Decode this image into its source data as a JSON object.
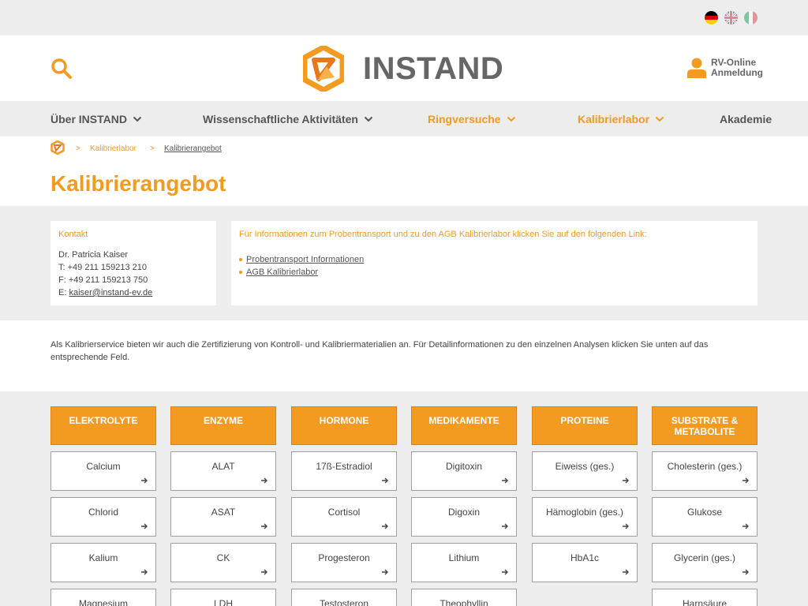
{
  "colors": {
    "accent": "#f39a21",
    "gray_bg": "#ededed",
    "text": "#444444"
  },
  "languages": [
    "Deutsch",
    "English",
    "Italiano"
  ],
  "brand": {
    "name": "INSTAND"
  },
  "header": {
    "login_line1": "RV-Online",
    "login_line2": "Anmeldung"
  },
  "nav": {
    "items": [
      {
        "label": "Über INSTAND"
      },
      {
        "label": "Wissenschaftliche Aktivitäten"
      },
      {
        "label": "Ringversuche"
      },
      {
        "label": "Kalibrierlabor"
      },
      {
        "label": "Akademie"
      }
    ]
  },
  "breadcrumb": {
    "sep": ">",
    "items": [
      "Kalibrierlabor",
      "Kalibrierangebot"
    ]
  },
  "page": {
    "title": "Kalibrierangebot"
  },
  "contact": {
    "label": "Kontakt",
    "name": "Dr. Patricia Kaiser",
    "phone": "T: +49 211 159213 210",
    "fax": "F: +49 211 159213 750",
    "email_prefix": "E: ",
    "email": "kaiser@instand-ev.de"
  },
  "links": {
    "intro": "Für Informationen zum Probentransport und zu den AGB Kalibrierlabor klicken Sie auf den folgenden Link:",
    "items": [
      "Probentransport Informationen",
      "AGB Kalibrierlabor"
    ]
  },
  "description": "Als Kalibrierservice bieten wir auch die Zertifizierung von Kontroll- und Kalibriermaterialien an. Für Detailinformationen zu den einzelnen Analysen klicken Sie unten auf das entsprechende Feld.",
  "categories": [
    {
      "title": "ELEKTROLYTE",
      "items": [
        "Calcium",
        "Chlorid",
        "Kalium",
        "Magnesium"
      ]
    },
    {
      "title": "ENZYME",
      "items": [
        "ALAT",
        "ASAT",
        "CK",
        "LDH"
      ]
    },
    {
      "title": "HORMONE",
      "items": [
        "17ß-Estradiol",
        "Cortisol",
        "Progesteron",
        "Testosteron"
      ]
    },
    {
      "title": "MEDIKAMENTE",
      "items": [
        "Digitoxin",
        "Digoxin",
        "Lithium",
        "Theophyllin"
      ]
    },
    {
      "title": "PROTEINE",
      "items": [
        "Eiweiss (ges.)",
        "Hämoglobin (ges.)",
        "HbA1c"
      ]
    },
    {
      "title": "SUBSTRATE & METABOLITE",
      "items": [
        "Cholesterin (ges.)",
        "Glukose",
        "Glycerin (ges.)",
        "Harnsäure"
      ]
    }
  ]
}
